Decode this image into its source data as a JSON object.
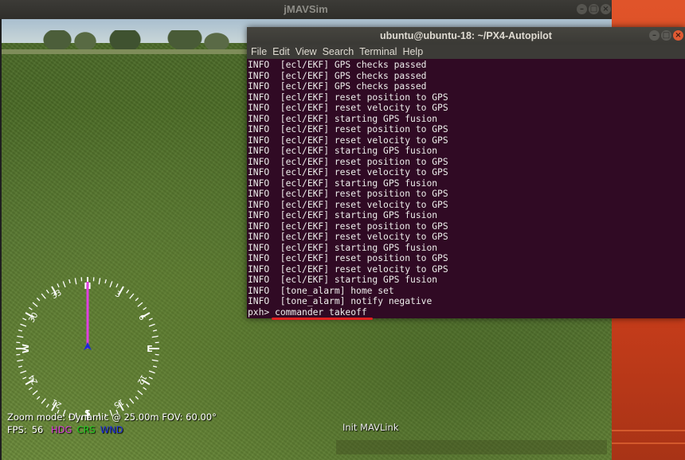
{
  "jmavsim": {
    "title": "jMAVSim",
    "status_text": "Init MAVLink",
    "hud": {
      "zoom_line": "Zoom mode: Dynamic @ 25.00m   FOV: 60.00°",
      "fps_label": "FPS:",
      "fps_value": "56",
      "hdg_label": "HDG",
      "crs_label": "CRS",
      "wnd_label": "WND",
      "hdg_color": "#e040e0",
      "crs_color": "#20d020",
      "wnd_color": "#2030e0"
    },
    "compass": {
      "north": "N",
      "south": "S",
      "east": "E",
      "west": "W",
      "t3": "3",
      "t6": "6",
      "t12": "12",
      "t15": "15",
      "t21": "21",
      "t24": "24",
      "t30": "30",
      "t33": "33",
      "heading_indicator_color": "#e040e0"
    }
  },
  "terminal": {
    "title": "ubuntu@ubuntu-18: ~/PX4-Autopilot",
    "menu": [
      "File",
      "Edit",
      "View",
      "Search",
      "Terminal",
      "Help"
    ],
    "lines": [
      "INFO  [ecl/EKF] GPS checks passed",
      "INFO  [ecl/EKF] GPS checks passed",
      "INFO  [ecl/EKF] GPS checks passed",
      "INFO  [ecl/EKF] reset position to GPS",
      "INFO  [ecl/EKF] reset velocity to GPS",
      "INFO  [ecl/EKF] starting GPS fusion",
      "INFO  [ecl/EKF] reset position to GPS",
      "INFO  [ecl/EKF] reset velocity to GPS",
      "INFO  [ecl/EKF] starting GPS fusion",
      "INFO  [ecl/EKF] reset position to GPS",
      "INFO  [ecl/EKF] reset velocity to GPS",
      "INFO  [ecl/EKF] starting GPS fusion",
      "INFO  [ecl/EKF] reset position to GPS",
      "INFO  [ecl/EKF] reset velocity to GPS",
      "INFO  [ecl/EKF] starting GPS fusion",
      "INFO  [ecl/EKF] reset position to GPS",
      "INFO  [ecl/EKF] reset velocity to GPS",
      "INFO  [ecl/EKF] starting GPS fusion",
      "INFO  [ecl/EKF] reset position to GPS",
      "INFO  [ecl/EKF] reset velocity to GPS",
      "INFO  [ecl/EKF] starting GPS fusion",
      "INFO  [tone_alarm] home set",
      "INFO  [tone_alarm] notify negative"
    ],
    "prompt": "pxh> ",
    "command": "commander takeoff",
    "highlight_color": "#e02020"
  }
}
